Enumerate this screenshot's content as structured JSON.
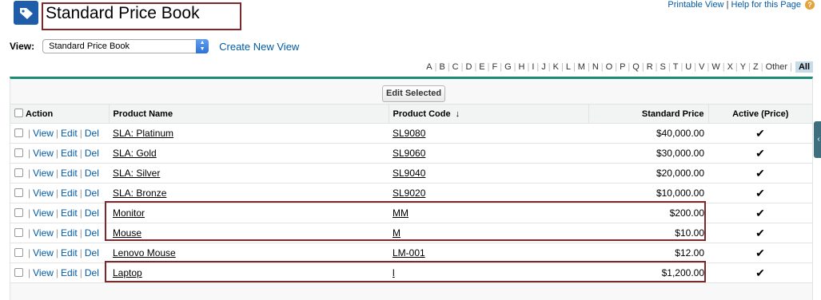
{
  "top_links": {
    "printable": "Printable View",
    "sep": "|",
    "help": "Help for this Page",
    "help_icon": "help-icon"
  },
  "header": {
    "title": "Standard Price Book",
    "icon": "price-tag-icon",
    "brand_color": "#1f5ca9"
  },
  "view": {
    "label": "View:",
    "selected": "Standard Price Book",
    "create_link": "Create New View"
  },
  "alphabet": [
    "A",
    "B",
    "C",
    "D",
    "E",
    "F",
    "G",
    "H",
    "I",
    "J",
    "K",
    "L",
    "M",
    "N",
    "O",
    "P",
    "Q",
    "R",
    "S",
    "T",
    "U",
    "V",
    "W",
    "X",
    "Y",
    "Z",
    "Other",
    "All"
  ],
  "alphabet_selected": "All",
  "toolbar": {
    "edit_selected": "Edit Selected"
  },
  "table": {
    "headers": {
      "action": "Action",
      "name": "Product Name",
      "code": "Product Code",
      "price": "Standard Price",
      "active": "Active (Price)"
    },
    "sort_indicator": "↓",
    "action_links": {
      "view": "View",
      "edit": "Edit",
      "del": "Del",
      "sep": "|"
    },
    "rows": [
      {
        "name": "SLA: Platinum",
        "code": "SL9080",
        "price": "$40,000.00",
        "active": "✔"
      },
      {
        "name": "SLA: Gold",
        "code": "SL9060",
        "price": "$30,000.00",
        "active": "✔"
      },
      {
        "name": "SLA: Silver",
        "code": "SL9040",
        "price": "$20,000.00",
        "active": "✔"
      },
      {
        "name": "SLA: Bronze",
        "code": "SL9020",
        "price": "$10,000.00",
        "active": "✔"
      },
      {
        "name": "Monitor",
        "code": "MM",
        "price": "$200.00",
        "active": "✔"
      },
      {
        "name": "Mouse",
        "code": "M",
        "price": "$10.00",
        "active": "✔"
      },
      {
        "name": "Lenovo Mouse",
        "code": "LM-001",
        "price": "$12.00",
        "active": "✔"
      },
      {
        "name": "Laptop",
        "code": "l",
        "price": "$1,200.00",
        "active": "✔"
      }
    ]
  },
  "colors": {
    "accent_border": "#1b8c72",
    "highlight_box": "#7a2a2a",
    "link": "#015ba7"
  }
}
